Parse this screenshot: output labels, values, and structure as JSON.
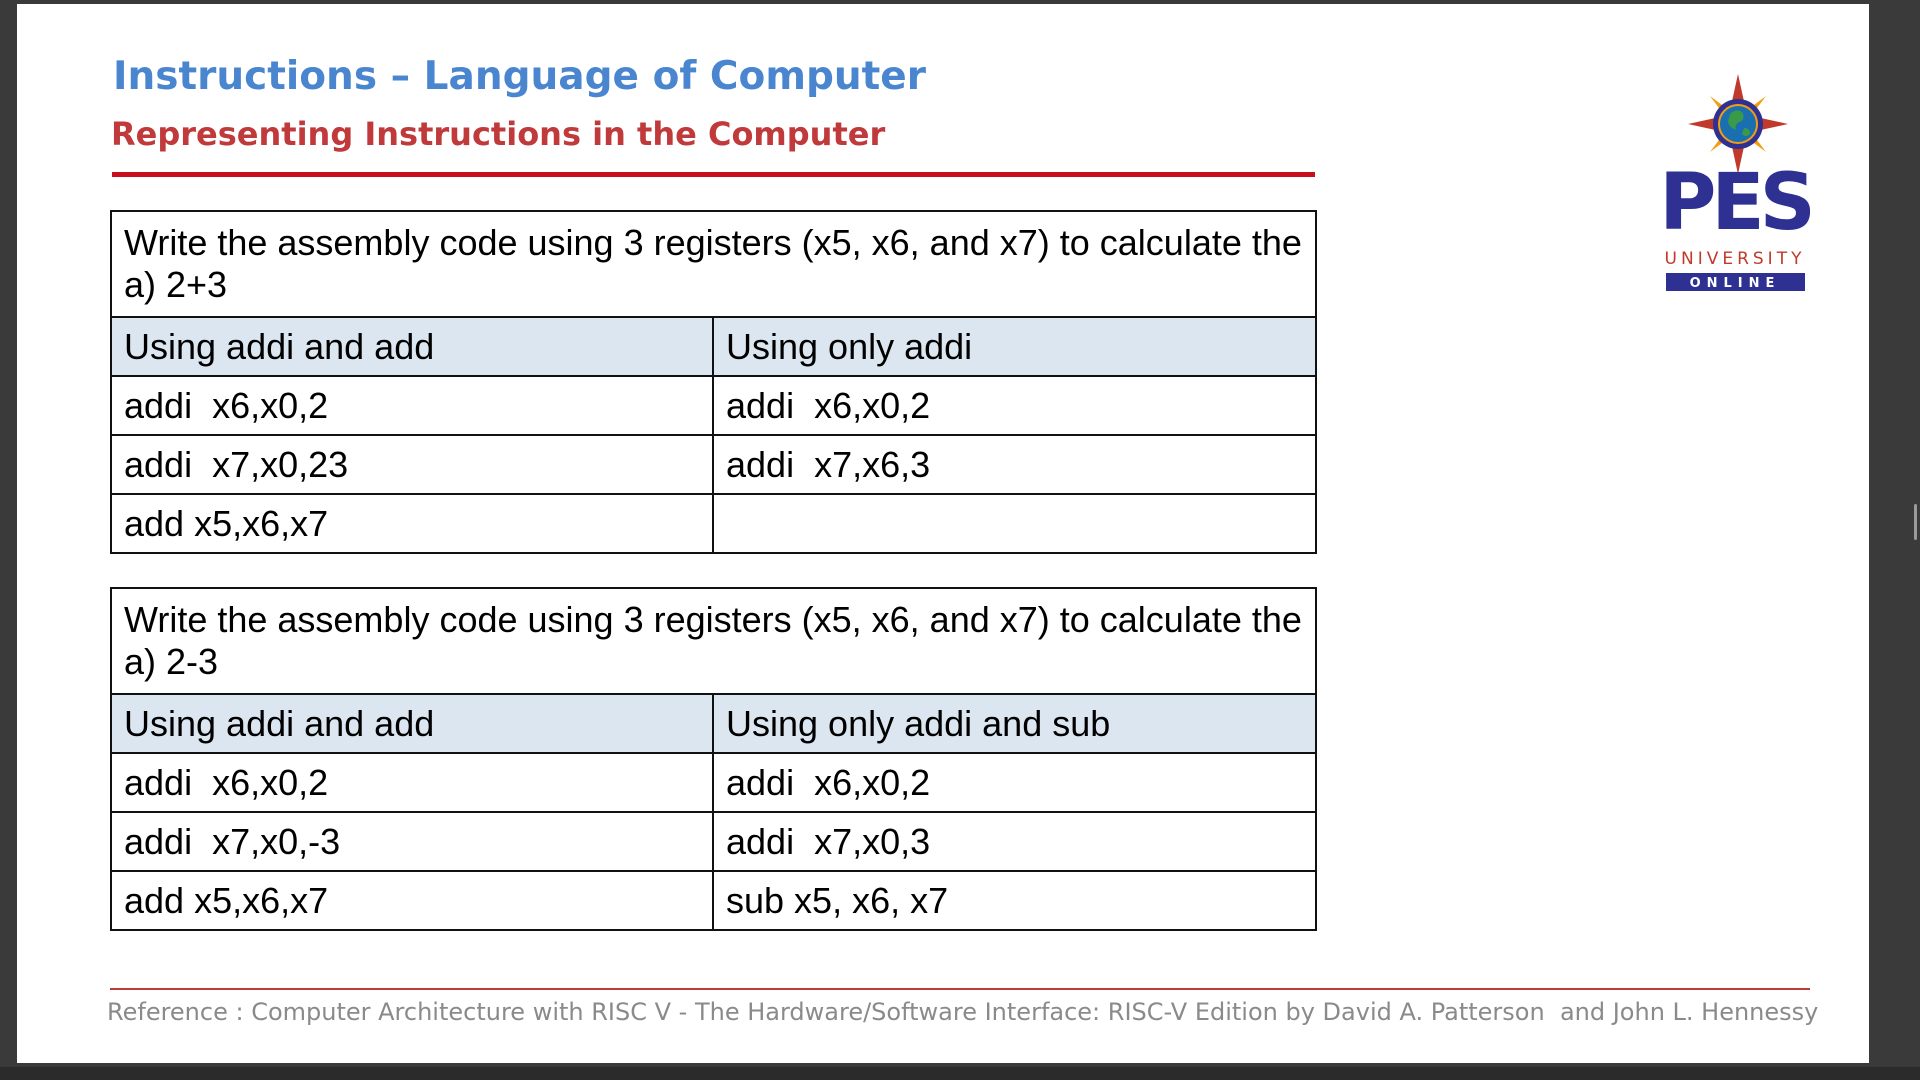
{
  "slide": {
    "title": "Instructions – Language of Computer",
    "subtitle": "Representing Instructions in the Computer"
  },
  "logo": {
    "name": "PES",
    "line1": "UNIVERSITY",
    "line2": "ONLINE",
    "icon": "compass-globe-icon",
    "colors": {
      "navy": "#2e3192",
      "red": "#c0392b",
      "orange": "#f39c12"
    }
  },
  "table1": {
    "question": "Write the assembly code using 3 registers (x5, x6, and x7) to calculate the a) 2+3",
    "headers": [
      "Using addi and add",
      "Using only addi"
    ],
    "rows": [
      [
        "addi  x6,x0,2",
        "addi  x6,x0,2"
      ],
      [
        "addi  x7,x0,23",
        "addi  x7,x6,3"
      ],
      [
        "add x5,x6,x7",
        ""
      ]
    ]
  },
  "table2": {
    "question": "Write the assembly code using 3 registers (x5, x6, and x7) to calculate the a) 2-3",
    "headers": [
      "Using addi and add",
      "Using only addi and sub"
    ],
    "rows": [
      [
        "addi  x6,x0,2",
        "addi  x6,x0,2"
      ],
      [
        "addi  x7,x0,-3",
        "addi  x7,x0,3"
      ],
      [
        "add x5,x6,x7",
        "sub x5, x6, x7"
      ]
    ]
  },
  "footer": {
    "reference": "Reference : Computer Architecture with RISC V - The Hardware/Software Interface: RISC-V Edition by David A. Patterson  and John L. Hennessy"
  },
  "colors": {
    "title": "#4a86d0",
    "subtitle": "#c0393b",
    "rule": "#c8101c",
    "table_header_bg": "#dce6f1",
    "footer_text": "#8a8a8a"
  }
}
